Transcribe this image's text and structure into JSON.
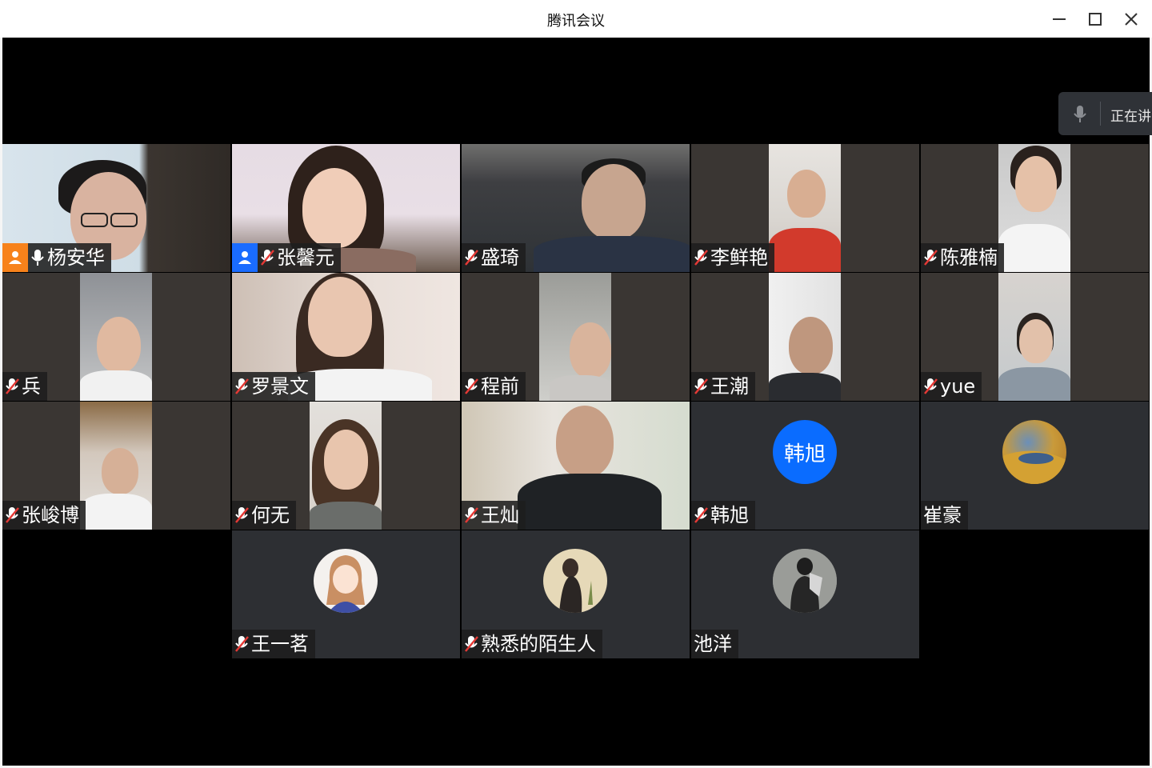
{
  "window": {
    "title": "腾讯会议"
  },
  "controls": {
    "minimize_icon": "minimize-icon",
    "maximize_icon": "maximize-icon",
    "close_icon": "close-icon"
  },
  "speaking": {
    "label": "正在讲"
  },
  "participants": [
    {
      "name": "杨安华",
      "mic": "on",
      "role": "host"
    },
    {
      "name": "张馨元",
      "mic": "muted",
      "role": "cohost"
    },
    {
      "name": "盛琦",
      "mic": "muted"
    },
    {
      "name": "李鲜艳",
      "mic": "muted"
    },
    {
      "name": "陈雅楠",
      "mic": "muted"
    },
    {
      "name": "兵",
      "mic": "muted"
    },
    {
      "name": "罗景文",
      "mic": "muted"
    },
    {
      "name": "程前",
      "mic": "muted"
    },
    {
      "name": "王潮",
      "mic": "muted"
    },
    {
      "name": "yue",
      "mic": "muted"
    },
    {
      "name": "张峻博",
      "mic": "muted"
    },
    {
      "name": "何无",
      "mic": "muted"
    },
    {
      "name": "王灿",
      "mic": "muted"
    },
    {
      "name": "韩旭",
      "mic": "muted",
      "avatar_text": "韩旭"
    },
    {
      "name": "崔豪",
      "mic": "none"
    },
    {
      "name": "王一茗",
      "mic": "muted"
    },
    {
      "name": "熟悉的陌生人",
      "mic": "muted"
    },
    {
      "name": "池洋",
      "mic": "none"
    }
  ],
  "colors": {
    "host_badge": "#f7821b",
    "cohost_badge": "#1a6cff",
    "avatar_blue": "#0a6cff"
  }
}
